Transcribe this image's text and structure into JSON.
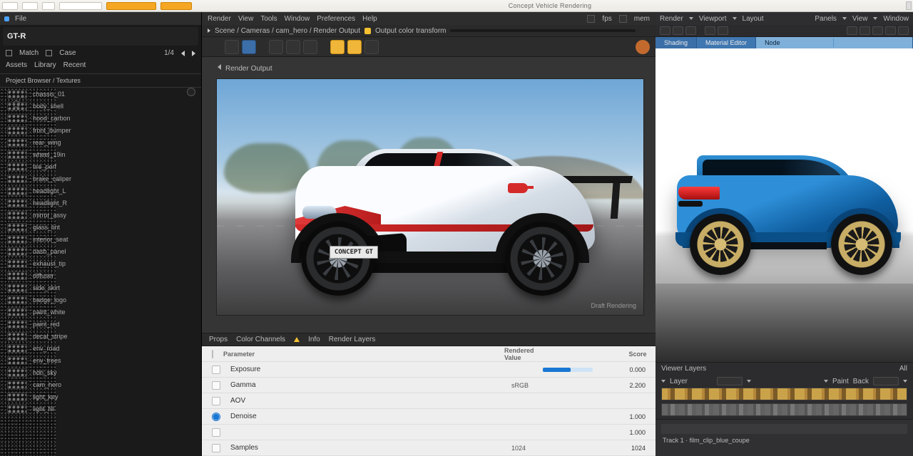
{
  "ribbon": {
    "center_title": "Concept Vehicle Rendering"
  },
  "left": {
    "menu": {
      "file": "File"
    },
    "search": "GT-R",
    "opt_a": "Match",
    "opt_b": "Case",
    "count": "1/4",
    "tab_a": "Assets",
    "tab_b": "Library",
    "tab_c": "Recent",
    "subhead": "Project Browser / Textures",
    "items": [
      {
        "nm": "chassis_01"
      },
      {
        "nm": "body_shell"
      },
      {
        "nm": "hood_carbon"
      },
      {
        "nm": "front_bumper"
      },
      {
        "nm": "rear_wing"
      },
      {
        "nm": "wheel_19in"
      },
      {
        "nm": "tire_perf"
      },
      {
        "nm": "brake_caliper"
      },
      {
        "nm": "headlight_L"
      },
      {
        "nm": "headlight_R"
      },
      {
        "nm": "mirror_assy"
      },
      {
        "nm": "glass_tint"
      },
      {
        "nm": "interior_seat"
      },
      {
        "nm": "dash_panel"
      },
      {
        "nm": "exhaust_tip"
      },
      {
        "nm": "diffuser"
      },
      {
        "nm": "side_skirt"
      },
      {
        "nm": "badge_logo"
      },
      {
        "nm": "paint_white"
      },
      {
        "nm": "paint_red"
      },
      {
        "nm": "decal_stripe"
      },
      {
        "nm": "env_road"
      },
      {
        "nm": "env_trees"
      },
      {
        "nm": "hdri_sky"
      },
      {
        "nm": "cam_hero"
      },
      {
        "nm": "light_key"
      },
      {
        "nm": "light_fill"
      }
    ]
  },
  "mid": {
    "menu": {
      "a": "Render",
      "b": "View",
      "c": "Tools",
      "d": "Window",
      "e": "Preferences",
      "f": "Help"
    },
    "menu_right_a": "fps",
    "menu_right_b": "mem",
    "path_a": "Scene / Cameras / cam_hero / Render Output",
    "path_warn": "Output color transform",
    "caption": "Render Output",
    "plate": "CONCEPT GT",
    "watermark": "Draft Rendering",
    "btabs": {
      "a": "Props",
      "b": "Color Channels",
      "c": "Info",
      "d": "Render Layers"
    },
    "grid": {
      "hdr_name": "Parameter",
      "hdr_mid": "Rendered Value",
      "hdr_val": "Score",
      "rows": [
        {
          "pname": "Exposure",
          "pmid": "",
          "pval": "0.000",
          "bar": true
        },
        {
          "pname": "Gamma",
          "pmid": "sRGB",
          "pval": "2.200"
        },
        {
          "pname": "AOV",
          "pmid": "",
          "pval": ""
        },
        {
          "pname": "Denoise",
          "pmid": "",
          "pval": "1.000",
          "radio": true
        },
        {
          "pname": "",
          "pmid": "",
          "pval": "1.000"
        },
        {
          "pname": "Samples",
          "pmid": "1024",
          "pval": "1024"
        }
      ]
    }
  },
  "right": {
    "menu": {
      "a": "Render",
      "b": "Viewport",
      "c": "Layout",
      "d": "Panels",
      "e": "View",
      "f": "Render",
      "g": "Window"
    },
    "tabs": {
      "a": "Shading",
      "b": "Material Editor",
      "c": "Node"
    },
    "bhead": "Viewer Layers",
    "bhead_r": "All",
    "row1": {
      "lbl": "Layer",
      "a": "Paint",
      "b": "Back"
    },
    "lane_lab": "Track 1 · film_clip_blue_coupe"
  }
}
